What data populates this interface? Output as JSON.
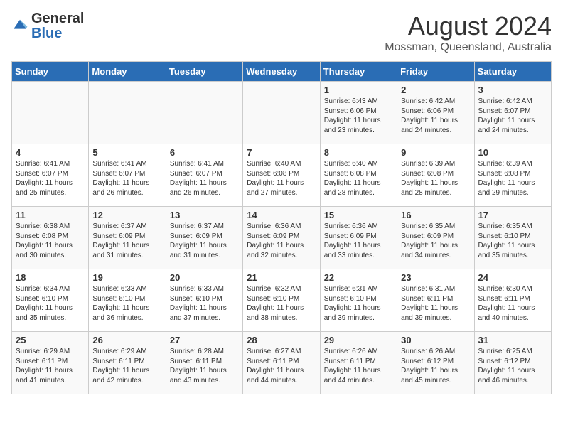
{
  "header": {
    "logo_general": "General",
    "logo_blue": "Blue",
    "title": "August 2024",
    "subtitle": "Mossman, Queensland, Australia"
  },
  "weekdays": [
    "Sunday",
    "Monday",
    "Tuesday",
    "Wednesday",
    "Thursday",
    "Friday",
    "Saturday"
  ],
  "weeks": [
    [
      {
        "day": "",
        "info": ""
      },
      {
        "day": "",
        "info": ""
      },
      {
        "day": "",
        "info": ""
      },
      {
        "day": "",
        "info": ""
      },
      {
        "day": "1",
        "info": "Sunrise: 6:43 AM\nSunset: 6:06 PM\nDaylight: 11 hours and 23 minutes."
      },
      {
        "day": "2",
        "info": "Sunrise: 6:42 AM\nSunset: 6:06 PM\nDaylight: 11 hours and 24 minutes."
      },
      {
        "day": "3",
        "info": "Sunrise: 6:42 AM\nSunset: 6:07 PM\nDaylight: 11 hours and 24 minutes."
      }
    ],
    [
      {
        "day": "4",
        "info": "Sunrise: 6:41 AM\nSunset: 6:07 PM\nDaylight: 11 hours and 25 minutes."
      },
      {
        "day": "5",
        "info": "Sunrise: 6:41 AM\nSunset: 6:07 PM\nDaylight: 11 hours and 26 minutes."
      },
      {
        "day": "6",
        "info": "Sunrise: 6:41 AM\nSunset: 6:07 PM\nDaylight: 11 hours and 26 minutes."
      },
      {
        "day": "7",
        "info": "Sunrise: 6:40 AM\nSunset: 6:08 PM\nDaylight: 11 hours and 27 minutes."
      },
      {
        "day": "8",
        "info": "Sunrise: 6:40 AM\nSunset: 6:08 PM\nDaylight: 11 hours and 28 minutes."
      },
      {
        "day": "9",
        "info": "Sunrise: 6:39 AM\nSunset: 6:08 PM\nDaylight: 11 hours and 28 minutes."
      },
      {
        "day": "10",
        "info": "Sunrise: 6:39 AM\nSunset: 6:08 PM\nDaylight: 11 hours and 29 minutes."
      }
    ],
    [
      {
        "day": "11",
        "info": "Sunrise: 6:38 AM\nSunset: 6:08 PM\nDaylight: 11 hours and 30 minutes."
      },
      {
        "day": "12",
        "info": "Sunrise: 6:37 AM\nSunset: 6:09 PM\nDaylight: 11 hours and 31 minutes."
      },
      {
        "day": "13",
        "info": "Sunrise: 6:37 AM\nSunset: 6:09 PM\nDaylight: 11 hours and 31 minutes."
      },
      {
        "day": "14",
        "info": "Sunrise: 6:36 AM\nSunset: 6:09 PM\nDaylight: 11 hours and 32 minutes."
      },
      {
        "day": "15",
        "info": "Sunrise: 6:36 AM\nSunset: 6:09 PM\nDaylight: 11 hours and 33 minutes."
      },
      {
        "day": "16",
        "info": "Sunrise: 6:35 AM\nSunset: 6:09 PM\nDaylight: 11 hours and 34 minutes."
      },
      {
        "day": "17",
        "info": "Sunrise: 6:35 AM\nSunset: 6:10 PM\nDaylight: 11 hours and 35 minutes."
      }
    ],
    [
      {
        "day": "18",
        "info": "Sunrise: 6:34 AM\nSunset: 6:10 PM\nDaylight: 11 hours and 35 minutes."
      },
      {
        "day": "19",
        "info": "Sunrise: 6:33 AM\nSunset: 6:10 PM\nDaylight: 11 hours and 36 minutes."
      },
      {
        "day": "20",
        "info": "Sunrise: 6:33 AM\nSunset: 6:10 PM\nDaylight: 11 hours and 37 minutes."
      },
      {
        "day": "21",
        "info": "Sunrise: 6:32 AM\nSunset: 6:10 PM\nDaylight: 11 hours and 38 minutes."
      },
      {
        "day": "22",
        "info": "Sunrise: 6:31 AM\nSunset: 6:10 PM\nDaylight: 11 hours and 39 minutes."
      },
      {
        "day": "23",
        "info": "Sunrise: 6:31 AM\nSunset: 6:11 PM\nDaylight: 11 hours and 39 minutes."
      },
      {
        "day": "24",
        "info": "Sunrise: 6:30 AM\nSunset: 6:11 PM\nDaylight: 11 hours and 40 minutes."
      }
    ],
    [
      {
        "day": "25",
        "info": "Sunrise: 6:29 AM\nSunset: 6:11 PM\nDaylight: 11 hours and 41 minutes."
      },
      {
        "day": "26",
        "info": "Sunrise: 6:29 AM\nSunset: 6:11 PM\nDaylight: 11 hours and 42 minutes."
      },
      {
        "day": "27",
        "info": "Sunrise: 6:28 AM\nSunset: 6:11 PM\nDaylight: 11 hours and 43 minutes."
      },
      {
        "day": "28",
        "info": "Sunrise: 6:27 AM\nSunset: 6:11 PM\nDaylight: 11 hours and 44 minutes."
      },
      {
        "day": "29",
        "info": "Sunrise: 6:26 AM\nSunset: 6:11 PM\nDaylight: 11 hours and 44 minutes."
      },
      {
        "day": "30",
        "info": "Sunrise: 6:26 AM\nSunset: 6:12 PM\nDaylight: 11 hours and 45 minutes."
      },
      {
        "day": "31",
        "info": "Sunrise: 6:25 AM\nSunset: 6:12 PM\nDaylight: 11 hours and 46 minutes."
      }
    ]
  ]
}
